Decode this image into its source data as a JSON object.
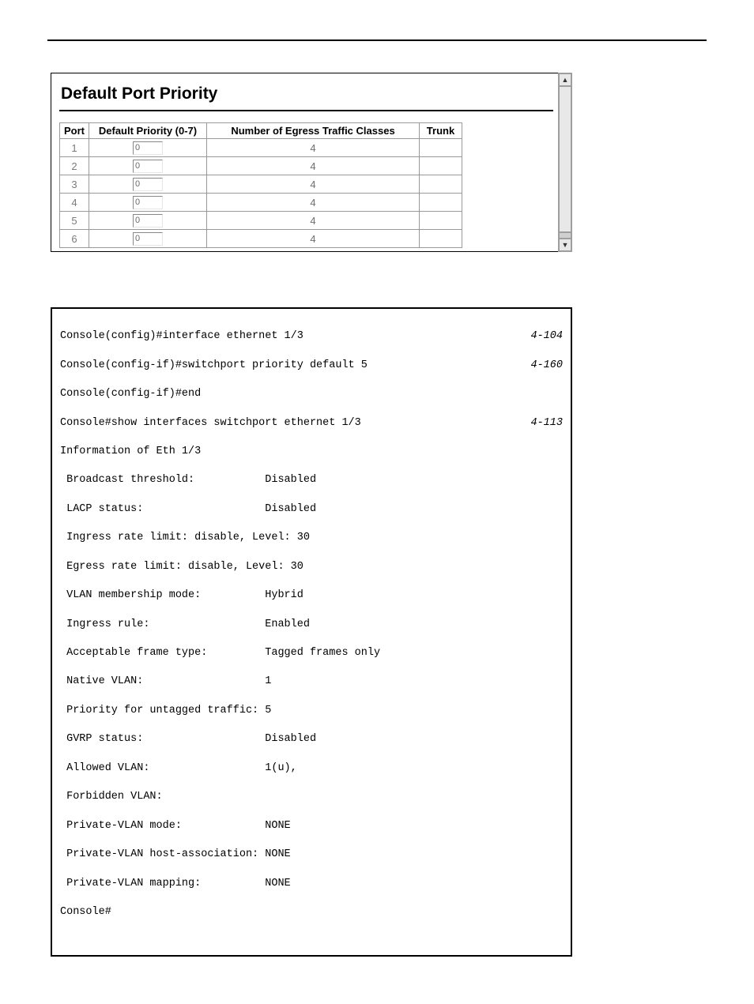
{
  "ui": {
    "title": "Default Port Priority",
    "headers": {
      "port": "Port",
      "priority": "Default Priority (0-7)",
      "egress": "Number of Egress Traffic Classes",
      "trunk": "Trunk"
    },
    "rows": [
      {
        "port": "1",
        "priority": "0",
        "egress": "4",
        "trunk": ""
      },
      {
        "port": "2",
        "priority": "0",
        "egress": "4",
        "trunk": ""
      },
      {
        "port": "3",
        "priority": "0",
        "egress": "4",
        "trunk": ""
      },
      {
        "port": "4",
        "priority": "0",
        "egress": "4",
        "trunk": ""
      },
      {
        "port": "5",
        "priority": "0",
        "egress": "4",
        "trunk": ""
      },
      {
        "port": "6",
        "priority": "0",
        "egress": "4",
        "trunk": ""
      }
    ]
  },
  "cli": {
    "lines": [
      {
        "text": "Console(config)#interface ethernet 1/3",
        "ref": "4-104"
      },
      {
        "text": "Console(config-if)#switchport priority default 5",
        "ref": "4-160"
      },
      {
        "text": "Console(config-if)#end",
        "ref": ""
      },
      {
        "text": "Console#show interfaces switchport ethernet 1/3",
        "ref": "4-113"
      },
      {
        "text": "Information of Eth 1/3",
        "ref": ""
      },
      {
        "text": " Broadcast threshold:           Disabled",
        "ref": ""
      },
      {
        "text": " LACP status:                   Disabled",
        "ref": ""
      },
      {
        "text": " Ingress rate limit: disable, Level: 30",
        "ref": ""
      },
      {
        "text": " Egress rate limit: disable, Level: 30",
        "ref": ""
      },
      {
        "text": " VLAN membership mode:          Hybrid",
        "ref": ""
      },
      {
        "text": " Ingress rule:                  Enabled",
        "ref": ""
      },
      {
        "text": " Acceptable frame type:         Tagged frames only",
        "ref": ""
      },
      {
        "text": " Native VLAN:                   1",
        "ref": ""
      },
      {
        "text": " Priority for untagged traffic: 5",
        "ref": ""
      },
      {
        "text": " GVRP status:                   Disabled",
        "ref": ""
      },
      {
        "text": " Allowed VLAN:                  1(u),",
        "ref": ""
      },
      {
        "text": " Forbidden VLAN:",
        "ref": ""
      },
      {
        "text": " Private-VLAN mode:             NONE",
        "ref": ""
      },
      {
        "text": " Private-VLAN host-association: NONE",
        "ref": ""
      },
      {
        "text": " Private-VLAN mapping:          NONE",
        "ref": ""
      },
      {
        "text": "Console#",
        "ref": ""
      }
    ]
  }
}
